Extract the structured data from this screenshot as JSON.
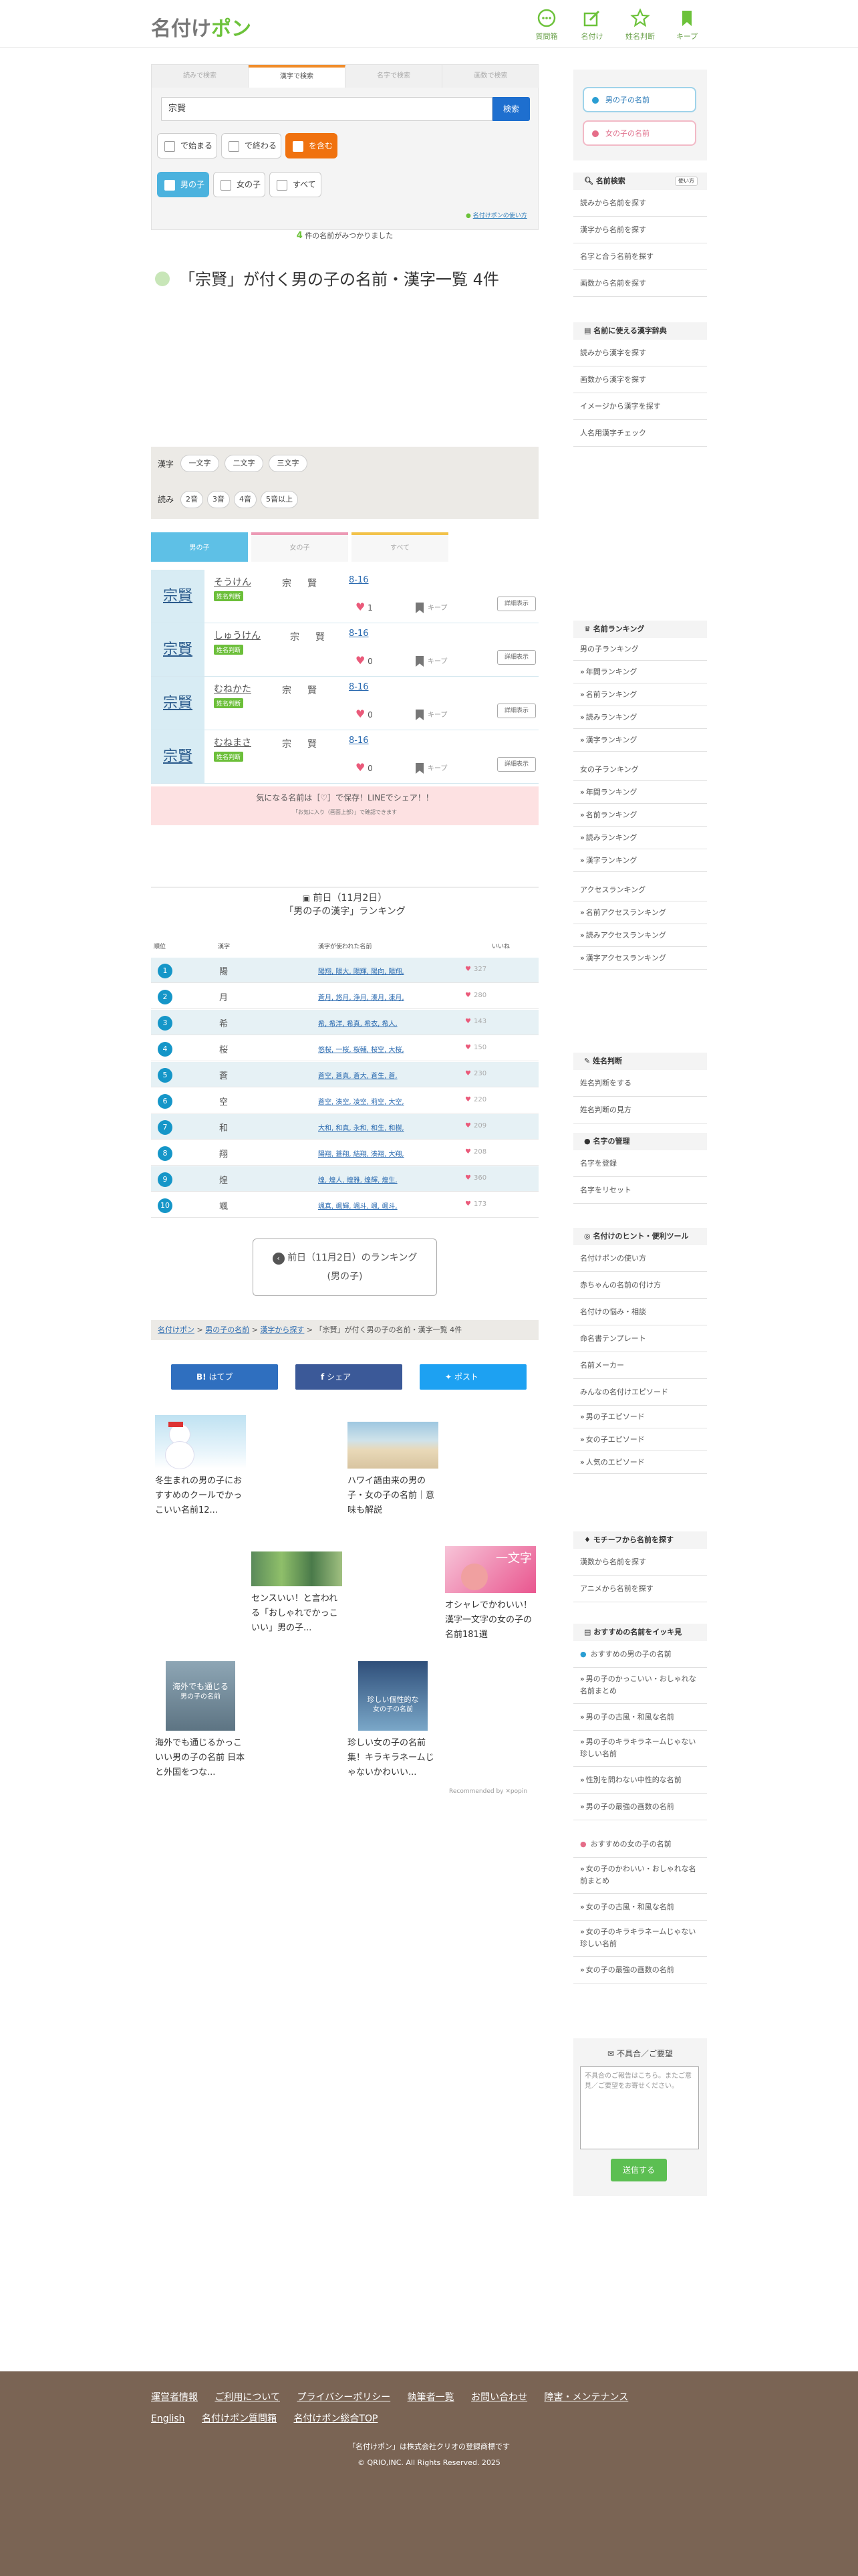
{
  "header": {
    "logo_a": "名付け",
    "logo_b": "ポン",
    "nav": [
      {
        "label": "質問箱",
        "icon": "chat-icon"
      },
      {
        "label": "名付け",
        "icon": "edit-icon"
      },
      {
        "label": "姓名判断",
        "icon": "star-icon"
      },
      {
        "label": "キープ",
        "icon": "bookmark-icon"
      }
    ]
  },
  "search": {
    "tabs": [
      "読みで検索",
      "漢字で検索",
      "名字で検索",
      "画数で検索"
    ],
    "value": "宗賢",
    "button": "検索",
    "options": [
      "で始まる",
      "で終わる",
      "を含む"
    ],
    "genders": [
      "男の子",
      "女の子",
      "すべて"
    ],
    "howto": "名付けポンの使い方"
  },
  "result": {
    "count": "4",
    "count_suffix": " 件の名前がみつかりました",
    "title": "「宗賢」が付く男の子の名前・漢字一覧 4件"
  },
  "filter": {
    "kanji_label": "漢字",
    "kanji_opts": [
      "一文字",
      "二文字",
      "三文字"
    ],
    "read_label": "読み",
    "read_opts": [
      "2音",
      "3音",
      "4音",
      "5音以上"
    ]
  },
  "rtabs": [
    "男の子",
    "女の子",
    "すべて"
  ],
  "rows": [
    {
      "kanji": "宗賢",
      "reading": "そうけん",
      "badge": "姓名判断",
      "c1": "宗",
      "c2": "賢",
      "strokes": "8-16",
      "likes": "1",
      "keep": "キープ",
      "detail": "詳細表示"
    },
    {
      "kanji": "宗賢",
      "reading": "しゅうけん",
      "badge": "姓名判断",
      "c1": "宗",
      "c2": "賢",
      "strokes": "8-16",
      "likes": "0",
      "keep": "キープ",
      "detail": "詳細表示"
    },
    {
      "kanji": "宗賢",
      "reading": "むねかた",
      "badge": "姓名判断",
      "c1": "宗",
      "c2": "賢",
      "strokes": "8-16",
      "likes": "0",
      "keep": "キープ",
      "detail": "詳細表示"
    },
    {
      "kanji": "宗賢",
      "reading": "むねまさ",
      "badge": "姓名判断",
      "c1": "宗",
      "c2": "賢",
      "strokes": "8-16",
      "likes": "0",
      "keep": "キープ",
      "detail": "詳細表示"
    }
  ],
  "savebar": {
    "main": "気になる名前は［♡］で保存！LINEでシェア！！",
    "sub": "「お気に入り（画面上部）」で確認できます"
  },
  "ranking": {
    "date": "前日（11月2日）",
    "title": "「男の子の漢字」ランキング",
    "cols": [
      "順位",
      "漢字",
      "漢字が使われた名前",
      "いいね"
    ],
    "items": [
      {
        "n": "1",
        "k": "陽",
        "names": "陽翔, 陽大, 陽輝, 陽向, 陽翔,",
        "likes": "327"
      },
      {
        "n": "2",
        "k": "月",
        "names": "蒼月, 悠月, 浄月, 湊月, 凍月,",
        "likes": "280"
      },
      {
        "n": "3",
        "k": "希",
        "names": "希, 希洋, 希真, 希衣, 希人,",
        "likes": "143"
      },
      {
        "n": "4",
        "k": "桜",
        "names": "悠桜, 一桜, 桜輔, 桜空, 大桜,",
        "likes": "150"
      },
      {
        "n": "5",
        "k": "蒼",
        "names": "蒼空, 蒼真, 蒼大, 蒼生, 蒼,",
        "likes": "230"
      },
      {
        "n": "6",
        "k": "空",
        "names": "蒼空, 湊空, 凌空, 莉空, 大空,",
        "likes": "220"
      },
      {
        "n": "7",
        "k": "和",
        "names": "大和, 和真, 永和, 和生, 和樹,",
        "likes": "209"
      },
      {
        "n": "8",
        "k": "翔",
        "names": "陽翔, 蒼翔, 結翔, 湊翔, 大翔,",
        "likes": "208"
      },
      {
        "n": "9",
        "k": "煌",
        "names": "煌, 煌人, 煌雅, 煌輝, 煌生,",
        "likes": "360"
      },
      {
        "n": "10",
        "k": "颯",
        "names": "颯真, 颯輝, 颯斗, 颯, 颯斗,",
        "likes": "173"
      }
    ],
    "prev_a": "前日（11月2日）のランキング",
    "prev_b": "(男の子)"
  },
  "breadcrumb": [
    "名付けポン",
    "男の子の名前",
    "漢字から探す",
    "「宗賢」が付く男の子の名前・漢字一覧 4件"
  ],
  "share": [
    "はてブ",
    "シェア",
    "ポスト"
  ],
  "recs": [
    {
      "t": "冬生まれの男の子におすすめのクールでかっこいい名前12..."
    },
    {
      "t": "ハワイ語由来の男の子・女の子の名前｜意味も解説"
    },
    {
      "t": "センスいい！と言われる「おしゃれでかっこいい」男の子..."
    },
    {
      "t": "オシャレでかわいい！漢字一文字の女の子の名前181選"
    },
    {
      "t": "海外でも通じるかっこいい男の子の名前 日本と外国をつな..."
    },
    {
      "t": "珍しい女の子の名前集！キラキラネームじゃないかわいい..."
    }
  ],
  "rec_img_text": {
    "r4": "一文字",
    "r5a": "海外でも通じる",
    "r5b": "男の子の名前",
    "r6a": "珍しい個性的な",
    "r6b": "女の子の名前"
  },
  "popin": "Recommended by ✕popin",
  "sidebar": {
    "gender": [
      "男の子の名前",
      "女の子の名前"
    ],
    "search_head": "名前検索",
    "howto": "使い方",
    "search_links": [
      "読みから名前を探す",
      "漢字から名前を探す",
      "名字と合う名前を探す",
      "画数から名前を探す"
    ],
    "dict_head": "名前に使える漢字辞典",
    "dict_links": [
      "読みから漢字を探す",
      "画数から漢字を探す",
      "イメージから漢字を探す",
      "人名用漢字チェック"
    ],
    "rank_head": "名前ランキング",
    "rank_boy": [
      "男の子ランキング",
      "年間ランキング",
      "名前ランキング",
      "読みランキング",
      "漢字ランキング"
    ],
    "rank_girl": [
      "女の子ランキング",
      "年間ランキング",
      "名前ランキング",
      "読みランキング",
      "漢字ランキング"
    ],
    "rank_access": [
      "アクセスランキング",
      "名前アクセスランキング",
      "読みアクセスランキング",
      "漢字アクセスランキング"
    ],
    "judge_head": "姓名判断",
    "judge_links": [
      "姓名判断をする",
      "姓名判断の見方"
    ],
    "myoji_head": "名字の管理",
    "myoji_links": [
      "名字を登録",
      "名字をリセット"
    ],
    "tools_head": "名付けのヒント・便利ツール",
    "tools_links": [
      "名付けポンの使い方",
      "赤ちゃんの名前の付け方",
      "名付けの悩み・相談",
      "命名書テンプレート",
      "名前メーカー",
      "みんなの名付けエピソード",
      "男の子エピソード",
      "女の子エピソード",
      "人気のエピソード"
    ],
    "motif_head": "モチーフから名前を探す",
    "motif_links": [
      "漢数から名前を探す",
      "アニメから名前を探す"
    ],
    "reco_head": "おすすめの名前をイッキ見",
    "reco_boy": [
      "おすすめの男の子の名前",
      "男の子のかっこいい・おしゃれな名前まとめ",
      "男の子の古風・和風な名前",
      "男の子のキラキラネームじゃない珍しい名前",
      "性別を問わない中性的な名前",
      "男の子の最強の画数の名前"
    ],
    "reco_girl": [
      "おすすめの女の子の名前",
      "女の子のかわいい・おしゃれな名前まとめ",
      "女の子の古風・和風な名前",
      "女の子のキラキラネームじゃない珍しい名前",
      "女の子の最強の画数の名前"
    ],
    "fb_title": "不具合／ご要望",
    "fb_placeholder": "不具合のご報告はこちら。またご意見／ご要望をお寄せください。",
    "fb_button": "送信する"
  },
  "footer": {
    "row1": [
      "運営者情報",
      "ご利用について",
      "プライバシーポリシー",
      "執筆者一覧",
      "お問い合わせ",
      "障害・メンテナンス"
    ],
    "row2": [
      "English",
      "名付けポン質問箱",
      "名付けポン総合TOP"
    ],
    "copy1": "「名付けポン」は株式会社クリオの登録商標です",
    "copy2": "© QRIO,INC. All Rights Reserved. 2025"
  },
  "colors": {
    "brand_green": "#6cc23a",
    "accent_orange": "#f0720f",
    "tab_blue": "#5ec0e6",
    "footer": "#7a6454"
  }
}
